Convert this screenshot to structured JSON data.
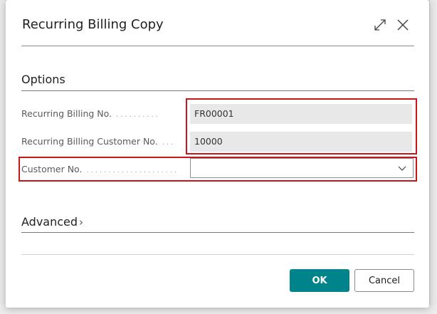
{
  "dialog": {
    "title": "Recurring Billing Copy"
  },
  "options": {
    "section_title": "Options",
    "fields": [
      {
        "label": "Recurring Billing No.",
        "value": "FR00001"
      },
      {
        "label": "Recurring Billing Customer No.",
        "value": "10000"
      }
    ],
    "customer_no": {
      "label": "Customer No.",
      "value": ""
    }
  },
  "advanced": {
    "label": "Advanced"
  },
  "buttons": {
    "ok": "OK",
    "cancel": "Cancel"
  },
  "colors": {
    "accent": "#00838a",
    "highlight": "#c8161d"
  },
  "icons": {
    "expand": "expand-icon",
    "close": "close-icon",
    "dropdown": "chevron-down-icon",
    "advanced": "chevron-right-icon"
  }
}
